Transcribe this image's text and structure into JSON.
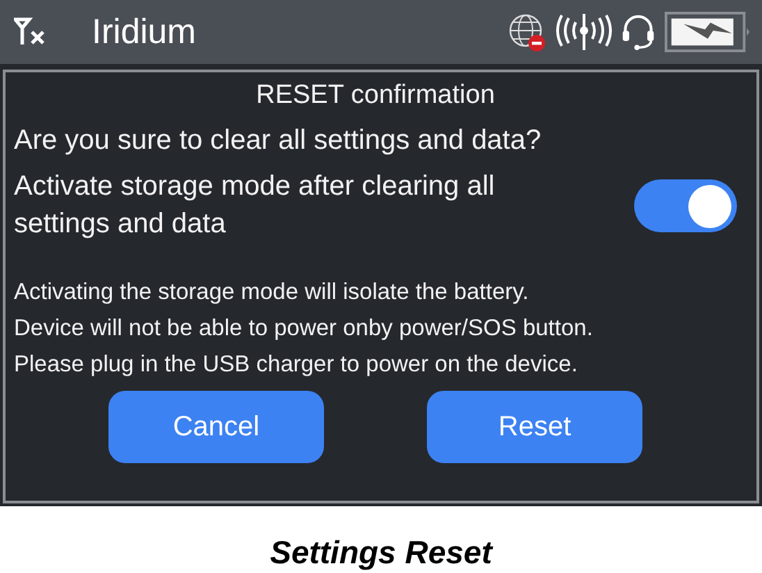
{
  "status_bar": {
    "title": "Iridium"
  },
  "dialog": {
    "title": "RESET confirmation",
    "question": "Are you sure to clear all settings and data?",
    "storage_mode": {
      "label": "Activate storage mode after clearing all settings and data",
      "on": true
    },
    "notes": [
      "Activating the storage mode will isolate the battery.",
      "Device will not be able to power onby power/SOS button.",
      "Please plug in the USB charger to power on the device."
    ],
    "buttons": [
      "Cancel",
      "Reset"
    ]
  },
  "caption": "Settings Reset"
}
